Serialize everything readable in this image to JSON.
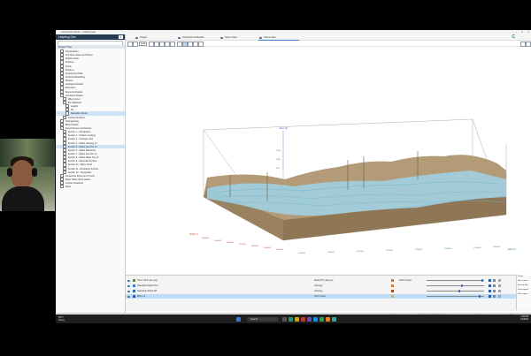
{
  "window": {
    "title": "Geodynamic Model - Leapfrog Geo"
  },
  "left_pane": {
    "app_name": "Leapfrog Geo",
    "header_button": "≡",
    "tree_header": "Project Tree",
    "tree": [
      {
        "label": "Topographies",
        "indent": 1
      },
      {
        "label": "GIS Data, Maps and Photos",
        "indent": 1
      },
      {
        "label": "Drillhole Data",
        "indent": 1
      },
      {
        "label": "Surfaces",
        "indent": 1
      },
      {
        "label": "Points",
        "indent": 1
      },
      {
        "label": "Polylines",
        "indent": 1
      },
      {
        "label": "Geophysical Data",
        "indent": 1
      },
      {
        "label": "Structural Modelling",
        "indent": 1
      },
      {
        "label": "Meshes",
        "indent": 1
      },
      {
        "label": "Geological Models",
        "indent": 1
      },
      {
        "label": "Estimation",
        "indent": 1
      },
      {
        "label": "Resource Models",
        "indent": 1
      },
      {
        "label": "Combined Models",
        "indent": 1
      },
      {
        "label": "Wiley Group",
        "indent": 2
      },
      {
        "label": "IDL Statistical",
        "indent": 2
      },
      {
        "label": "Logistic",
        "indent": 3
      },
      {
        "label": "FN",
        "indent": 3
      },
      {
        "label": "Saturation Model",
        "indent": 3,
        "selected": true
      },
      {
        "label": "Contact Surfaces",
        "indent": 2
      },
      {
        "label": "Hydrogeology",
        "indent": 1
      },
      {
        "label": "Block Models",
        "indent": 1
      },
      {
        "label": "Saved Scenes and Movies",
        "indent": 1
      },
      {
        "label": "Section 1 - Topography",
        "indent": 2
      },
      {
        "label": "Section 2 - Surface Geology",
        "indent": 2
      },
      {
        "label": "Section 3 - Geologic units",
        "indent": 2
      },
      {
        "label": "Section 4 - Model Geology Lit",
        "indent": 2
      },
      {
        "label": "Section 5 - Model Geo Pro Lit",
        "indent": 2,
        "selected": true
      },
      {
        "label": "Section 6 - Model Saturation",
        "indent": 2
      },
      {
        "label": "Section 7 - Model Geo Pro Lit",
        "indent": 2
      },
      {
        "label": "Section 8 - Model Water Pro Lit",
        "indent": 2
      },
      {
        "label": "Section 9 - Saturated Surface",
        "indent": 2
      },
      {
        "label": "Section 10 - Wiley Trend",
        "indent": 2
      },
      {
        "label": "Section 11 - Resistivity Surface",
        "indent": 2
      },
      {
        "label": "Section 12 - Polygonate",
        "indent": 2
      },
      {
        "label": "Geotechnic Flows and Trends",
        "indent": 1
      },
      {
        "label": "Water Table Observations",
        "indent": 1
      },
      {
        "label": "Contour Gradients",
        "indent": 1
      },
      {
        "label": "Notes",
        "indent": 1
      }
    ]
  },
  "tabs": [
    {
      "label": "Project"
    },
    {
      "label": "Hydrothermal Boards"
    },
    {
      "label": "Scene View"
    },
    {
      "label": "Scene View",
      "active": true
    }
  ],
  "toolbar": {
    "lock_label": "Lock",
    "brand": "C"
  },
  "scene": {
    "axis_north": "North (Y)",
    "axis_east": "East (X)",
    "axis_elev": "Elev (Z)",
    "x_ticks": [
      "1290000",
      "1300000",
      "1310000",
      "1320000",
      "1330000",
      "1340000",
      "1350000",
      "1360000"
    ],
    "y_ticks": [
      "1440000",
      "1450000",
      "1460000",
      "1470000",
      "1480000",
      "1490000",
      "1500000"
    ],
    "z_ticks": [
      "1500",
      "1000",
      "500"
    ]
  },
  "layers": [
    {
      "name": "Topo 1 (PC Lat.Long)",
      "item": "Model WT_data_pts",
      "style": "",
      "opacity": "100% Colour",
      "swatch": "#5a8a3a",
      "swatch2": "#b07a3a",
      "knob": 0.95
    },
    {
      "name": "Saturation Model FN-b",
      "item": "Lithology",
      "style": "",
      "opacity": "",
      "swatch": "#3a7bd5",
      "swatch2": "#d07a2a",
      "knob": 0.6
    },
    {
      "name": "Saturation Model WT",
      "item": "Lithology",
      "style": "",
      "opacity": "",
      "swatch": "#2c6fb0",
      "swatch2": "#a84a2a",
      "knob": 0.55
    },
    {
      "name": "Wiley Lit",
      "item": "Point Colour",
      "style": "",
      "opacity": "",
      "swatch": "#2a5fa8",
      "swatch2": "#c4b08a",
      "knob": 0.9,
      "selected": true
    }
  ],
  "properties": [
    "Shape",
    "Filter colours",
    "Exclude filter",
    "Show legend",
    "Show edges"
  ],
  "status": {
    "coords": "Non-Coordinate Systems",
    "position": "1309695.09, 1467612.33, 315.90",
    "no_code": "No Code",
    "acceleration": "Full Acceleration"
  },
  "taskbar": {
    "weather_temp": "26°C",
    "weather_desc": "Sunny",
    "search": "Search",
    "time": "4:49 PM",
    "date": "4/2/2024"
  }
}
